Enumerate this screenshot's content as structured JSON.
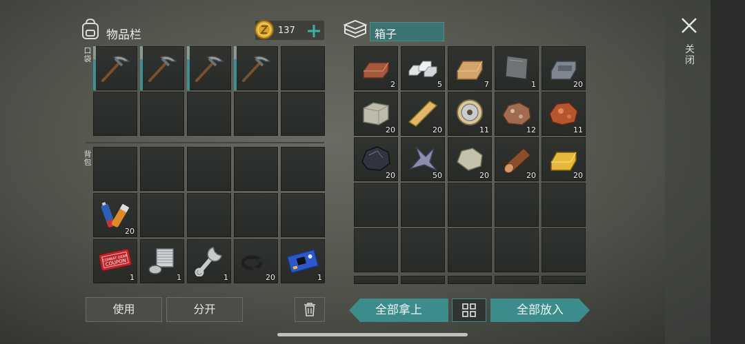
{
  "inventory": {
    "title": "物品栏",
    "coin_count": "137",
    "pocket_label": "口袋",
    "backpack_label": "背包",
    "pocket_slots": [
      {
        "icon": "pickaxe-icon",
        "count": ""
      },
      {
        "icon": "pickaxe-icon",
        "count": ""
      },
      {
        "icon": "pickaxe-icon",
        "count": ""
      },
      {
        "icon": "pickaxe-icon",
        "count": ""
      },
      {
        "icon": "",
        "count": ""
      },
      {
        "icon": "",
        "count": ""
      },
      {
        "icon": "",
        "count": ""
      },
      {
        "icon": "",
        "count": ""
      },
      {
        "icon": "",
        "count": ""
      },
      {
        "icon": "",
        "count": ""
      }
    ],
    "backpack_slots": [
      {
        "icon": "",
        "count": ""
      },
      {
        "icon": "",
        "count": ""
      },
      {
        "icon": "",
        "count": ""
      },
      {
        "icon": "",
        "count": ""
      },
      {
        "icon": "",
        "count": ""
      },
      {
        "icon": "battery-icon",
        "count": "20"
      },
      {
        "icon": "",
        "count": ""
      },
      {
        "icon": "",
        "count": ""
      },
      {
        "icon": "",
        "count": ""
      },
      {
        "icon": "",
        "count": ""
      },
      {
        "icon": "coupon-icon",
        "count": "1"
      },
      {
        "icon": "engine-cylinder-icon",
        "count": "1"
      },
      {
        "icon": "wrench-icon",
        "count": "1"
      },
      {
        "icon": "rubber-ring-icon",
        "count": "20"
      },
      {
        "icon": "circuit-board-icon",
        "count": "1"
      }
    ],
    "coupon_text": "COMBAT GEAR COUPON",
    "use_button": "使用",
    "split_button": "分开"
  },
  "box": {
    "name": "箱子",
    "slots": [
      {
        "icon": "copper-ingot-icon",
        "count": "2"
      },
      {
        "icon": "iron-ingots-icon",
        "count": "5"
      },
      {
        "icon": "wood-plank-icon",
        "count": "7"
      },
      {
        "icon": "metal-sheet-icon",
        "count": "1"
      },
      {
        "icon": "steel-ingot-icon",
        "count": "20"
      },
      {
        "icon": "stone-block-icon",
        "count": "20"
      },
      {
        "icon": "board-icon",
        "count": "20"
      },
      {
        "icon": "wire-spool-icon",
        "count": "11"
      },
      {
        "icon": "iron-ore-icon",
        "count": "12"
      },
      {
        "icon": "copper-ore-icon",
        "count": "11"
      },
      {
        "icon": "coal-icon",
        "count": "20"
      },
      {
        "icon": "crystal-icon",
        "count": "50"
      },
      {
        "icon": "stone-icon",
        "count": "20"
      },
      {
        "icon": "log-icon",
        "count": "20"
      },
      {
        "icon": "gold-ingot-icon",
        "count": "20"
      }
    ],
    "take_all": "全部拿上",
    "put_all": "全部放入"
  },
  "close_label": "关闭",
  "colors": {
    "teal": "#3c8c8c",
    "slot": "#2b2e2b"
  }
}
